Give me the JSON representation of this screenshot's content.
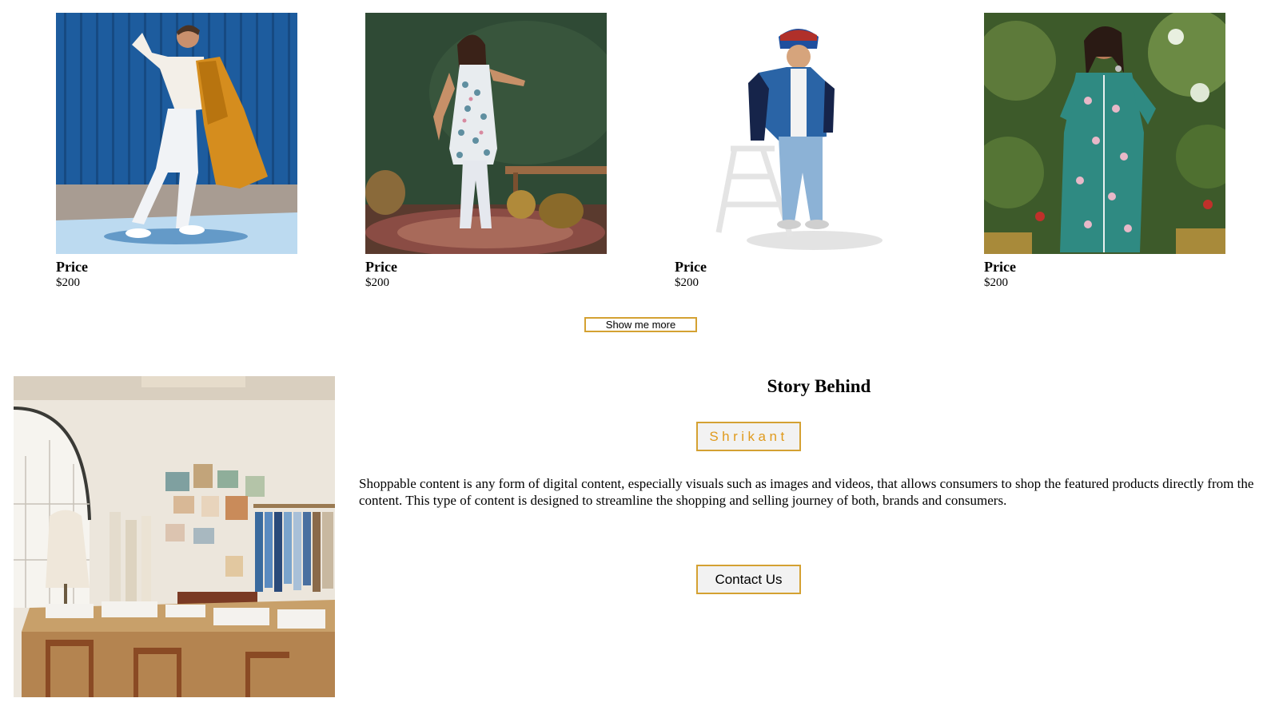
{
  "products": [
    {
      "price_label": "Price",
      "price": "$200",
      "image": "man-white-outfit-orange-coat-photo"
    },
    {
      "price_label": "Price",
      "price": "$200",
      "image": "woman-floral-suit-green-wall-photo"
    },
    {
      "price_label": "Price",
      "price": "$200",
      "image": "boy-denim-jacket-stepladder-photo"
    },
    {
      "price_label": "Price",
      "price": "$200",
      "image": "woman-teal-floral-kurta-garden-photo"
    }
  ],
  "show_more_label": "Show me more",
  "story": {
    "title": "Story Behind",
    "author": "Shrikant",
    "text": "Shoppable content is any form of digital content, especially visuals such as images and videos, that allows consumers to shop the featured products directly from the content. This type of content is designed to streamline the shopping and selling journey of both, brands and consumers.",
    "image": "fashion-design-studio-photo"
  },
  "contact_label": "Contact Us",
  "colors": {
    "button_border": "#d4a132",
    "author_text": "#e09a1c",
    "button_bg": "#f2f2f2"
  }
}
